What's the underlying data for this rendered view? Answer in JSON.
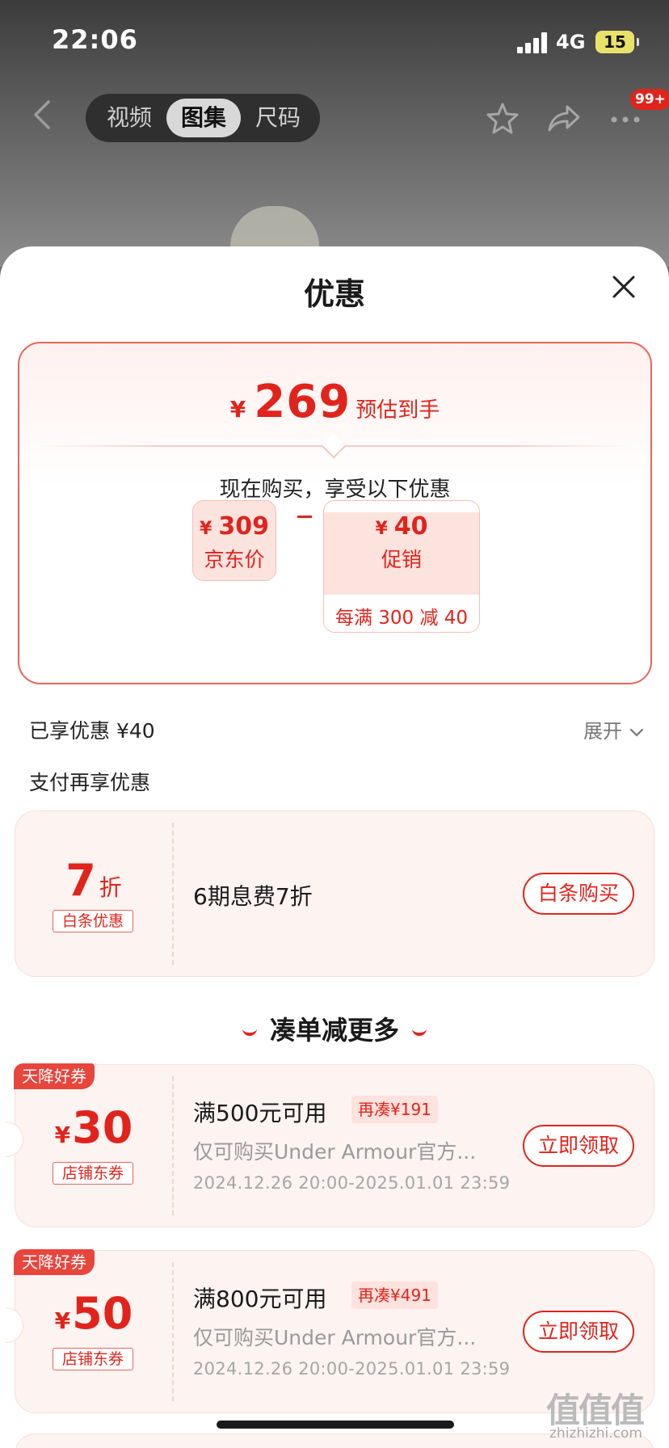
{
  "status_bar": {
    "time": "22:06",
    "network": "4G",
    "battery": "15"
  },
  "nav": {
    "tabs": [
      {
        "label": "视频",
        "active": false
      },
      {
        "label": "图集",
        "active": true
      },
      {
        "label": "尺码",
        "active": false
      }
    ],
    "more_badge": "99+"
  },
  "sheet": {
    "title": "优惠",
    "estimate": {
      "currency": "¥",
      "price": "269",
      "label": "预估到手"
    },
    "enjoy_text": "现在购买，享受以下优惠",
    "jd_price": {
      "currency": "¥",
      "value": "309",
      "label": "京东价"
    },
    "promo": {
      "currency": "¥",
      "value": "40",
      "label": "促销",
      "rule": "每满 300 减 40"
    },
    "enjoyed": "已享优惠 ¥40",
    "expand": "展开",
    "pay_more": "支付再享优惠",
    "baitiao": {
      "discount": "7",
      "unit": "折",
      "tag": "白条优惠",
      "title": "6期息费7折",
      "button": "白条购买"
    },
    "section_title": "凑单减更多",
    "coupons": [
      {
        "ribbon": "天降好券",
        "currency": "¥",
        "amount": "30",
        "tag": "店铺东券",
        "title": "满500元可用",
        "chip": "再凑¥191",
        "desc": "仅可购买Under Armour官方...",
        "date": "2024.12.26 20:00-2025.01.01 23:59",
        "button": "立即领取"
      },
      {
        "ribbon": "天降好券",
        "currency": "¥",
        "amount": "50",
        "tag": "店铺东券",
        "title": "满800元可用",
        "chip": "再凑¥491",
        "desc": "仅可购买Under Armour官方...",
        "date": "2024.12.26 20:00-2025.01.01 23:59",
        "button": "立即领取"
      }
    ]
  },
  "watermark": {
    "main": "值值值",
    "sub": "zhizhizhi.com"
  },
  "colors": {
    "accent": "#e0241c",
    "card_bg": "#fdf3f1",
    "chip_bg": "#fde2dd"
  },
  "icons": [
    "back-icon",
    "star-icon",
    "share-icon",
    "more-icon",
    "close-icon",
    "chevron-down-icon"
  ]
}
